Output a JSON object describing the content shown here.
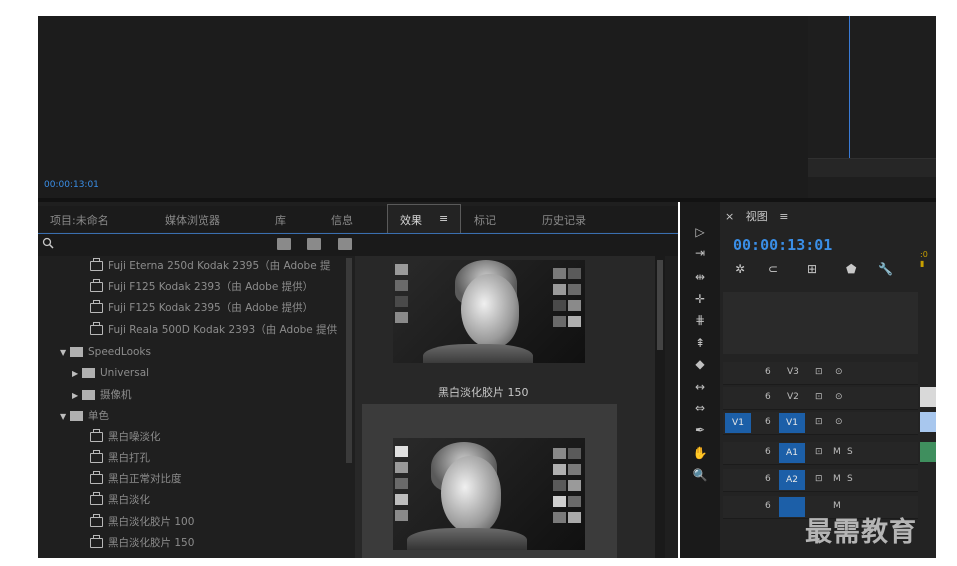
{
  "monitor": {
    "timecode": "00:00:13:01"
  },
  "tabs": [
    {
      "label": "项目:未命名"
    },
    {
      "label": "媒体浏览器"
    },
    {
      "label": "库"
    },
    {
      "label": "信息"
    },
    {
      "label": "效果"
    },
    {
      "label": "标记"
    },
    {
      "label": "历史记录"
    }
  ],
  "tab_menu_glyph": "≡",
  "effects_tree": {
    "items": [
      {
        "label": "Fuji Eterna 250d Kodak 2395（由 Adobe 提"
      },
      {
        "label": "Fuji F125 Kodak 2393（由 Adobe 提供）"
      },
      {
        "label": "Fuji F125 Kodak 2395（由 Adobe 提供）"
      },
      {
        "label": "Fuji Reala 500D Kodak 2393（由 Adobe 提供"
      },
      {
        "label": "SpeedLooks"
      },
      {
        "label": "Universal"
      },
      {
        "label": "摄像机"
      },
      {
        "label": "单色"
      },
      {
        "label": "黑白噪淡化"
      },
      {
        "label": "黑白打孔"
      },
      {
        "label": "黑白正常对比度"
      },
      {
        "label": "黑白淡化"
      },
      {
        "label": "黑白淡化胶片 100"
      },
      {
        "label": "黑白淡化胶片 150"
      }
    ]
  },
  "preview": {
    "caption": "黑白淡化胶片 150"
  },
  "timeline": {
    "close": "×",
    "title": "视图",
    "menu": "≡",
    "timecode": "00:00:13:01",
    "tracks": [
      {
        "name": "V3",
        "lock": "6",
        "sync": "⊡",
        "eye": "⊙"
      },
      {
        "name": "V2",
        "lock": "6",
        "sync": "⊡",
        "eye": "⊙"
      },
      {
        "name": "V1",
        "source": "V1",
        "lock": "6",
        "sync": "⊡",
        "eye": "⊙"
      },
      {
        "name": "A1",
        "lock": "6",
        "sync": "⊡",
        "m": "M",
        "s": "S"
      },
      {
        "name": "A2",
        "lock": "6",
        "sync": "⊡",
        "m": "M",
        "s": "S"
      },
      {
        "name": "",
        "lock": "6",
        "m": "M"
      }
    ]
  },
  "watermark": "最需教育",
  "colors": {
    "accent": "#3a8ee6",
    "track_blue": "#1c5fa8",
    "panel": "#1f1f1f"
  }
}
